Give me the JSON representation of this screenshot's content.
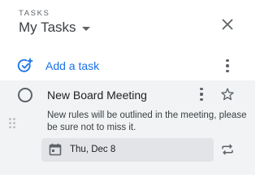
{
  "header": {
    "eyebrow": "TASKS",
    "list_name": "My Tasks",
    "caret_icon": "caret-down-icon",
    "close_icon": "close-icon"
  },
  "add_task": {
    "label": "Add a task",
    "icon": "add-task-icon",
    "more_icon": "more-vert-icon"
  },
  "tasks": [
    {
      "title": "New Board Meeting",
      "notes": "New rules will be outlined in the meeting, please be sure not to miss it.",
      "date": "Thu, Dec 8",
      "completed": false,
      "starred": false
    }
  ],
  "colors": {
    "accent": "#1a73e8",
    "task_bg": "#f1f3f4",
    "chip_bg": "#e2e4e7",
    "icon": "#5f6368"
  }
}
